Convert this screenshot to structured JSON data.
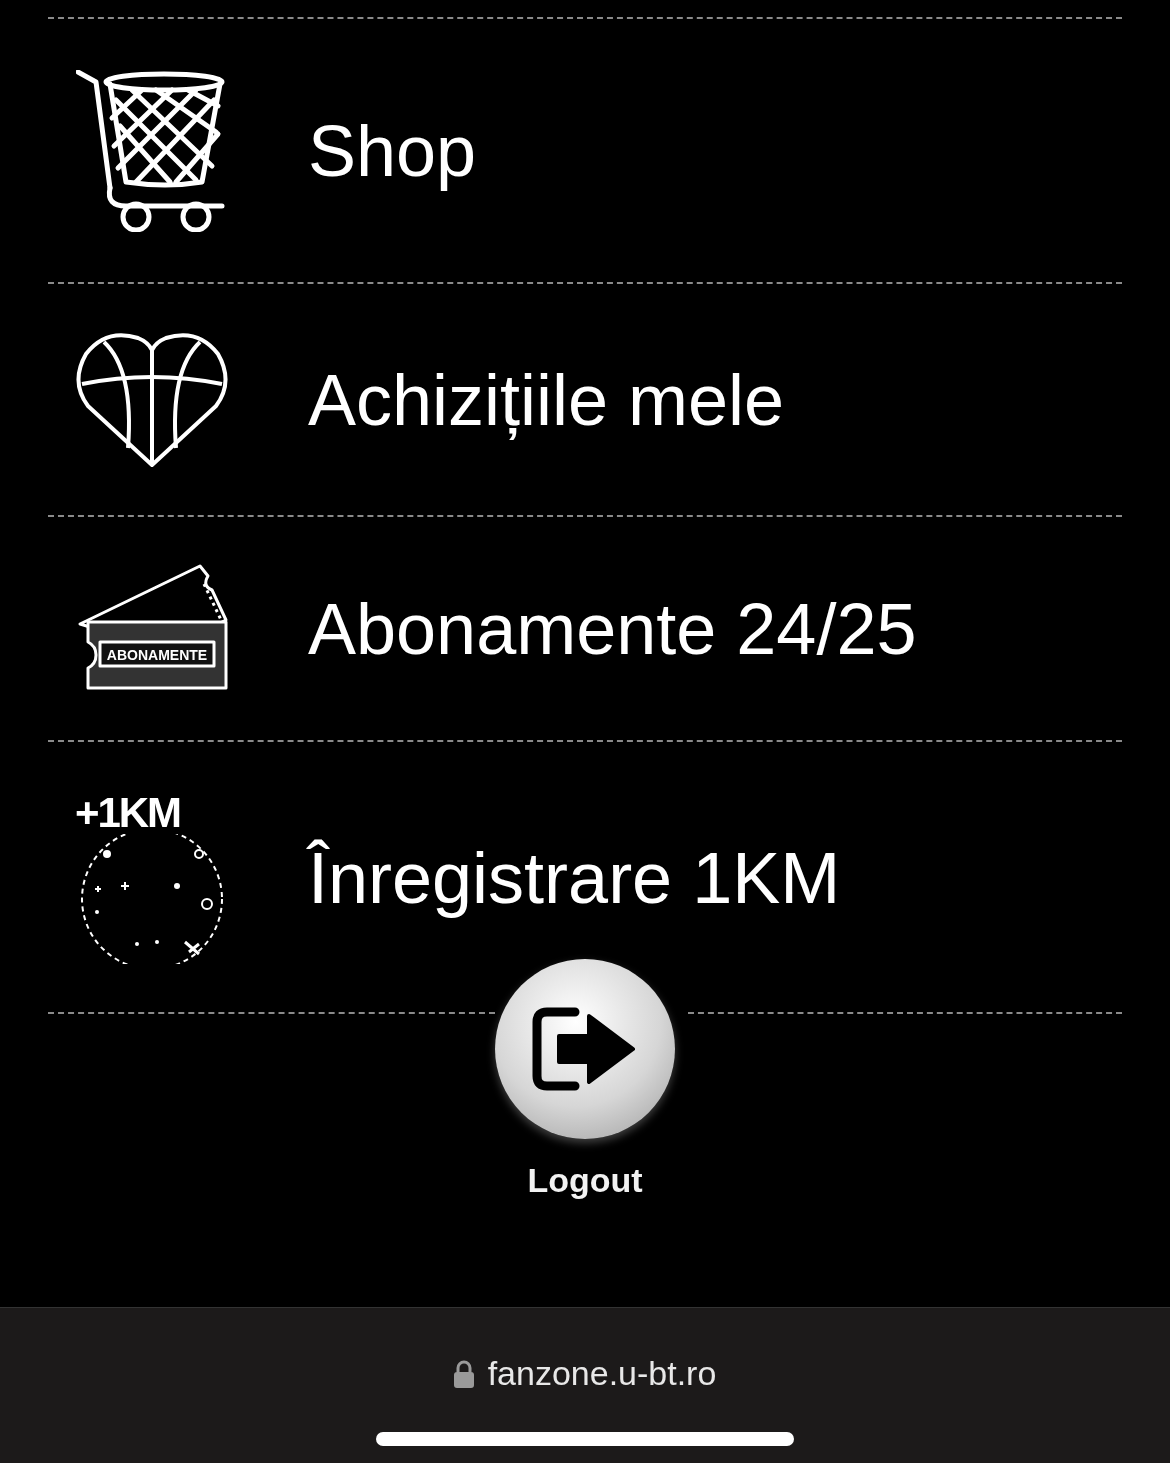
{
  "menu": [
    {
      "kind": "cart",
      "label": "Shop"
    },
    {
      "kind": "heart",
      "label": "Achizițiile mele"
    },
    {
      "kind": "ticket",
      "label": "Abonamente 24/25",
      "icon_text": "ABONAMENTE"
    },
    {
      "kind": "km",
      "label": "Înregistrare 1KM",
      "icon_text": "+1KM"
    }
  ],
  "logout": {
    "label": "Logout"
  },
  "address_bar": {
    "url": "fanzone.u-bt.ro"
  }
}
